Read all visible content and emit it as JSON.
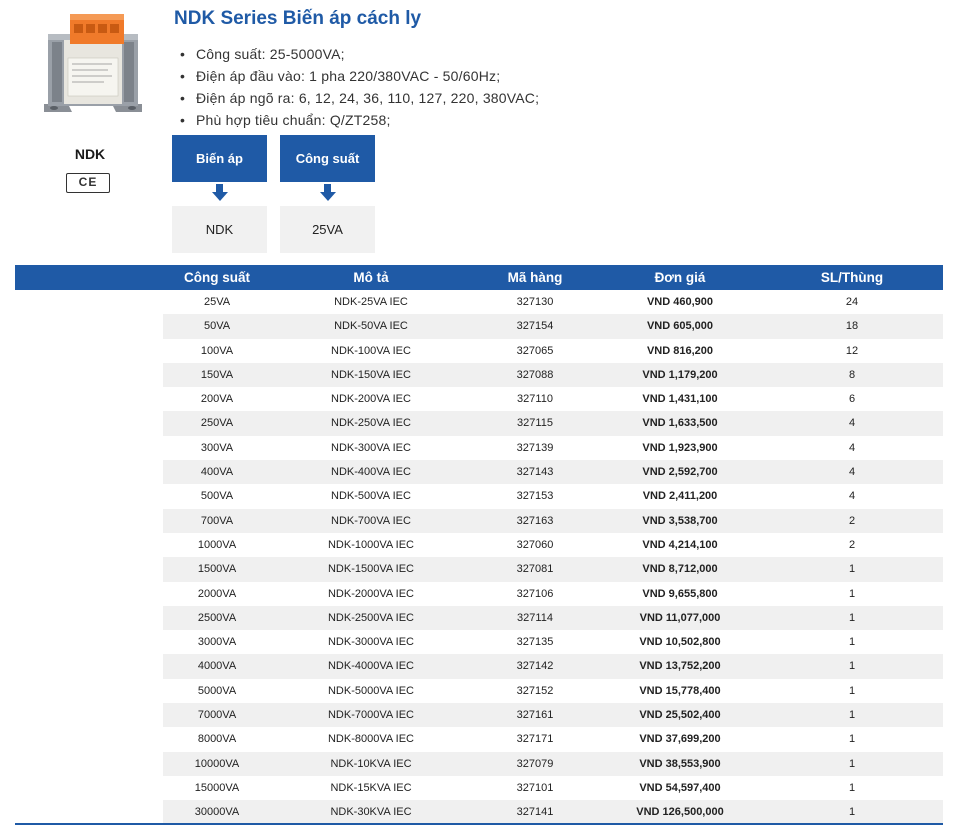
{
  "product": {
    "code": "NDK",
    "certification": "CE"
  },
  "header": {
    "title": "NDK Series Biến áp cách ly",
    "features": [
      "Công suất: 25-5000VA;",
      "Điện áp đầu vào: 1 pha 220/380VAC - 50/60Hz;",
      "Điện áp ngõ ra: 6, 12, 24, 36, 110, 127, 220, 380VAC;",
      "Phù hợp tiêu chuẩn: Q/ZT258;"
    ]
  },
  "selectors": [
    {
      "label": "Biến áp",
      "value": "NDK"
    },
    {
      "label": "Công suất",
      "value": "25VA"
    }
  ],
  "table": {
    "columns": [
      "Công suất",
      "Mô tả",
      "Mã hàng",
      "Đơn giá",
      "SL/Thùng"
    ],
    "rows": [
      [
        "25VA",
        "NDK-25VA IEC",
        "327130",
        "VND 460,900",
        "24"
      ],
      [
        "50VA",
        "NDK-50VA IEC",
        "327154",
        "VND 605,000",
        "18"
      ],
      [
        "100VA",
        "NDK-100VA IEC",
        "327065",
        "VND 816,200",
        "12"
      ],
      [
        "150VA",
        "NDK-150VA IEC",
        "327088",
        "VND 1,179,200",
        "8"
      ],
      [
        "200VA",
        "NDK-200VA IEC",
        "327110",
        "VND 1,431,100",
        "6"
      ],
      [
        "250VA",
        "NDK-250VA IEC",
        "327115",
        "VND 1,633,500",
        "4"
      ],
      [
        "300VA",
        "NDK-300VA IEC",
        "327139",
        "VND 1,923,900",
        "4"
      ],
      [
        "400VA",
        "NDK-400VA IEC",
        "327143",
        "VND 2,592,700",
        "4"
      ],
      [
        "500VA",
        "NDK-500VA IEC",
        "327153",
        "VND 2,411,200",
        "4"
      ],
      [
        "700VA",
        "NDK-700VA IEC",
        "327163",
        "VND 3,538,700",
        "2"
      ],
      [
        "1000VA",
        "NDK-1000VA IEC",
        "327060",
        "VND 4,214,100",
        "2"
      ],
      [
        "1500VA",
        "NDK-1500VA IEC",
        "327081",
        "VND 8,712,000",
        "1"
      ],
      [
        "2000VA",
        "NDK-2000VA IEC",
        "327106",
        "VND 9,655,800",
        "1"
      ],
      [
        "2500VA",
        "NDK-2500VA IEC",
        "327114",
        "VND 11,077,000",
        "1"
      ],
      [
        "3000VA",
        "NDK-3000VA IEC",
        "327135",
        "VND 10,502,800",
        "1"
      ],
      [
        "4000VA",
        "NDK-4000VA IEC",
        "327142",
        "VND 13,752,200",
        "1"
      ],
      [
        "5000VA",
        "NDK-5000VA IEC",
        "327152",
        "VND 15,778,400",
        "1"
      ],
      [
        "7000VA",
        "NDK-7000VA IEC",
        "327161",
        "VND 25,502,400",
        "1"
      ],
      [
        "8000VA",
        "NDK-8000VA IEC",
        "327171",
        "VND 37,699,200",
        "1"
      ],
      [
        "10000VA",
        "NDK-10KVA IEC",
        "327079",
        "VND 38,553,900",
        "1"
      ],
      [
        "15000VA",
        "NDK-15KVA IEC",
        "327101",
        "VND 54,597,400",
        "1"
      ],
      [
        "30000VA",
        "NDK-30KVA IEC",
        "327141",
        "VND 126,500,000",
        "1"
      ]
    ]
  },
  "colors": {
    "brand_blue": "#1f5aa6",
    "row_stripe": "#f0f0f0"
  }
}
